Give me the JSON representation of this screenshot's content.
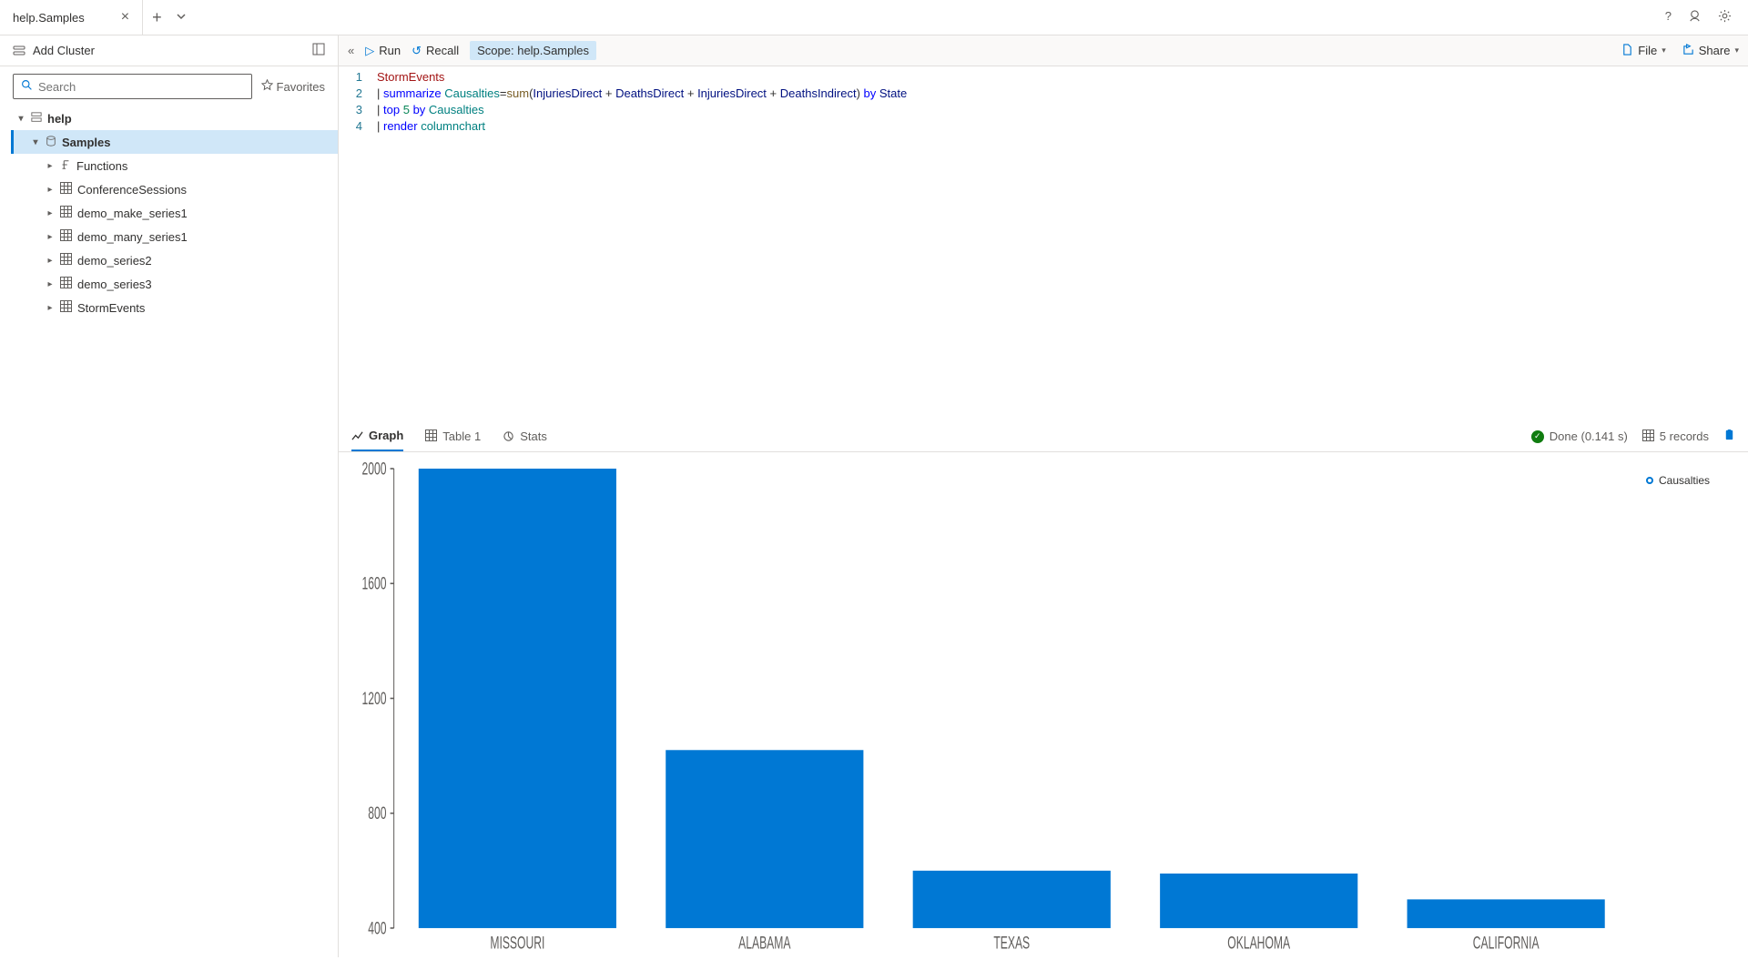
{
  "tab": {
    "title": "help.Samples"
  },
  "topIcons": {
    "help": "?",
    "feedback": "feedback-icon",
    "settings": "gear-icon"
  },
  "sidebar": {
    "addCluster": "Add Cluster",
    "searchPlaceholder": "Search",
    "favorites": "Favorites",
    "tree": {
      "root": "help",
      "db": "Samples",
      "items": [
        {
          "name": "Functions",
          "type": "fn"
        },
        {
          "name": "ConferenceSessions",
          "type": "table"
        },
        {
          "name": "demo_make_series1",
          "type": "table"
        },
        {
          "name": "demo_many_series1",
          "type": "table"
        },
        {
          "name": "demo_series2",
          "type": "table"
        },
        {
          "name": "demo_series3",
          "type": "table"
        },
        {
          "name": "StormEvents",
          "type": "table"
        }
      ]
    }
  },
  "toolbar": {
    "run": "Run",
    "recall": "Recall",
    "scope": "Scope: help.Samples",
    "file": "File",
    "share": "Share"
  },
  "editor": {
    "lines": [
      {
        "n": "1",
        "tokens": [
          {
            "t": "StormEvents",
            "c": "tk-tbl"
          }
        ]
      },
      {
        "n": "2",
        "tokens": [
          {
            "t": "| ",
            "c": "tk-op"
          },
          {
            "t": "summarize",
            "c": "tk-kw"
          },
          {
            "t": " ",
            "c": ""
          },
          {
            "t": "Causalties",
            "c": "tk-var"
          },
          {
            "t": "=",
            "c": "tk-op"
          },
          {
            "t": "sum",
            "c": "tk-fn"
          },
          {
            "t": "(",
            "c": "tk-op"
          },
          {
            "t": "InjuriesDirect",
            "c": "tk-col"
          },
          {
            "t": " + ",
            "c": "tk-op"
          },
          {
            "t": "DeathsDirect",
            "c": "tk-col"
          },
          {
            "t": " + ",
            "c": "tk-op"
          },
          {
            "t": "InjuriesDirect",
            "c": "tk-col"
          },
          {
            "t": " + ",
            "c": "tk-op"
          },
          {
            "t": "DeathsIndirect",
            "c": "tk-col"
          },
          {
            "t": ") ",
            "c": "tk-op"
          },
          {
            "t": "by",
            "c": "tk-kw"
          },
          {
            "t": " ",
            "c": ""
          },
          {
            "t": "State",
            "c": "tk-col"
          }
        ]
      },
      {
        "n": "3",
        "tokens": [
          {
            "t": "| ",
            "c": "tk-op"
          },
          {
            "t": "top",
            "c": "tk-kw"
          },
          {
            "t": " ",
            "c": ""
          },
          {
            "t": "5",
            "c": "tk-num"
          },
          {
            "t": " ",
            "c": ""
          },
          {
            "t": "by",
            "c": "tk-kw"
          },
          {
            "t": " ",
            "c": ""
          },
          {
            "t": "Causalties",
            "c": "tk-var"
          }
        ]
      },
      {
        "n": "4",
        "tokens": [
          {
            "t": "| ",
            "c": "tk-op"
          },
          {
            "t": "render",
            "c": "tk-kw"
          },
          {
            "t": " ",
            "c": ""
          },
          {
            "t": "columnchart",
            "c": "tk-var"
          }
        ]
      }
    ]
  },
  "results": {
    "tabs": {
      "graph": "Graph",
      "table": "Table 1",
      "stats": "Stats"
    },
    "status": "Done (0.141 s)",
    "records": "5 records"
  },
  "chart_data": {
    "type": "bar",
    "categories": [
      "MISSOURI",
      "ALABAMA",
      "TEXAS",
      "OKLAHOMA",
      "CALIFORNIA"
    ],
    "values": [
      2000,
      1020,
      600,
      590,
      500
    ],
    "series_name": "Causalties",
    "ylim": [
      400,
      2000
    ],
    "yticks": [
      400,
      800,
      1200,
      1600,
      2000
    ]
  }
}
